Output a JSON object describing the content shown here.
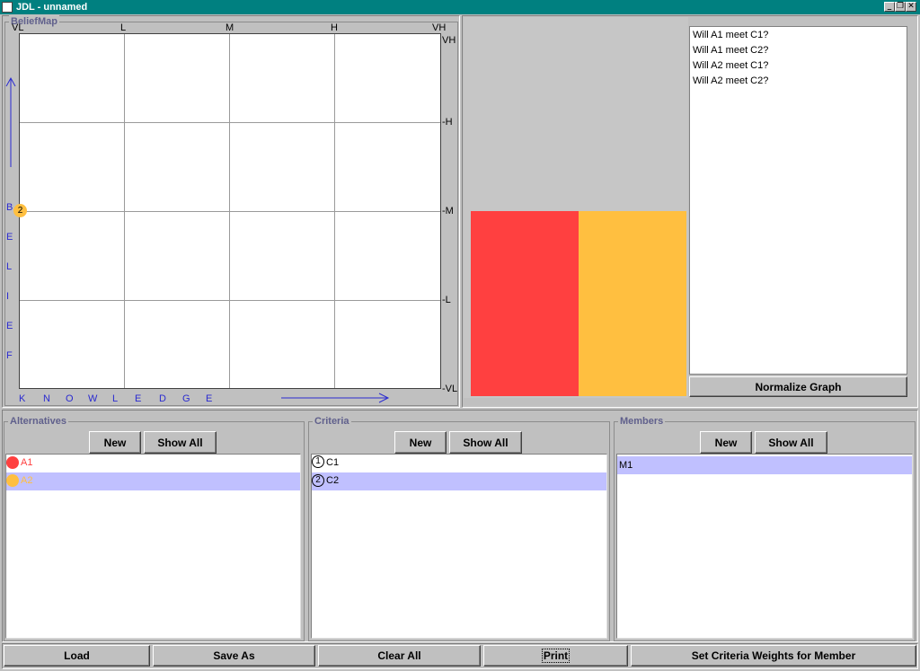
{
  "window": {
    "title": "JDL - unnamed"
  },
  "belief_map": {
    "title": "BeliefMap",
    "top_ticks": [
      "VL",
      "L",
      "M",
      "H",
      "VH"
    ],
    "right_ticks": [
      "VH",
      "-H",
      "-M",
      "-L",
      "-VL"
    ],
    "x_axis_letters": [
      "K",
      "N",
      "O",
      "W",
      "L",
      "E",
      "D",
      "G",
      "E"
    ],
    "y_axis_letters": [
      "B",
      "E",
      "L",
      "I",
      "E",
      "F"
    ],
    "marker_label": "2"
  },
  "graph": {
    "colors": {
      "alt1": "#ff4040",
      "alt2": "#ffbf40"
    },
    "questions": [
      "Will A1 meet C1?",
      "Will A1 meet C2?",
      "Will A2 meet C1?",
      "Will A2 meet C2?"
    ],
    "normalize_label": "Normalize Graph"
  },
  "alternatives": {
    "title": "Alternatives",
    "new_label": "New",
    "show_all_label": "Show All",
    "items": [
      {
        "label": "A1",
        "color": "#ff4040"
      },
      {
        "label": "A2",
        "color": "#ffbf40"
      }
    ]
  },
  "criteria": {
    "title": "Criteria",
    "new_label": "New",
    "show_all_label": "Show All",
    "items": [
      {
        "number": "1",
        "label": "C1"
      },
      {
        "number": "2",
        "label": "C2"
      }
    ]
  },
  "members": {
    "title": "Members",
    "new_label": "New",
    "show_all_label": "Show All",
    "items": [
      {
        "label": "M1"
      }
    ]
  },
  "footer": {
    "load": "Load",
    "save_as": "Save As",
    "clear_all": "Clear All",
    "print": "Print",
    "set_weights": "Set Criteria Weights for Member"
  }
}
